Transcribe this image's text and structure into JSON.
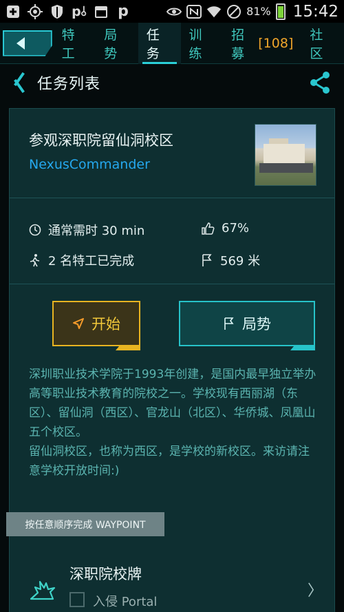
{
  "status_bar": {
    "icons": [
      "plus-box-icon",
      "crosshair-icon",
      "shield-icon",
      "pl-icon",
      "calendar-365-icon",
      "p-icon",
      "eye-icon",
      "nfc-icon",
      "wifi-icon",
      "no-signal-icon",
      "battery-icon"
    ],
    "battery_percent": "81%",
    "battery_level": 0.81,
    "time": "15:42"
  },
  "nav": {
    "tabs": [
      {
        "label": "特工",
        "active": false
      },
      {
        "label": "局势",
        "active": false
      },
      {
        "label": "任务",
        "active": true
      },
      {
        "label": "训练",
        "active": false
      },
      {
        "label": "招募",
        "count": "[108]",
        "active": false
      },
      {
        "label": "社区",
        "active": false
      }
    ]
  },
  "titlebar": {
    "title": "任务列表"
  },
  "mission": {
    "title": "参观深职院留仙洞校区",
    "author": "NexusCommander",
    "duration": "通常需时 30 min",
    "rating": "67%",
    "completed": "2 名特工已完成",
    "distance": "569 米",
    "start_label": "开始",
    "ops_label": "局势",
    "description": "深圳职业技术学院于1993年创建，是国内最早独立举办高等职业技术教育的院校之一。学校现有西丽湖（东区）、留仙洞（西区）、官龙山（北区）、华侨城、凤凰山五个校区。\n留仙洞校区，也称为西区，是学校的新校区。来访请注意学校开放时间:)"
  },
  "waypoints": {
    "order_label": "按任意顺序完成 WAYPOINT",
    "items": [
      {
        "title": "深职院校牌",
        "action": "入侵 Portal"
      }
    ]
  },
  "colors": {
    "accent": "#2bd0d8",
    "start": "#e8b421",
    "author": "#25a8ee",
    "description": "#5bb4b0"
  }
}
